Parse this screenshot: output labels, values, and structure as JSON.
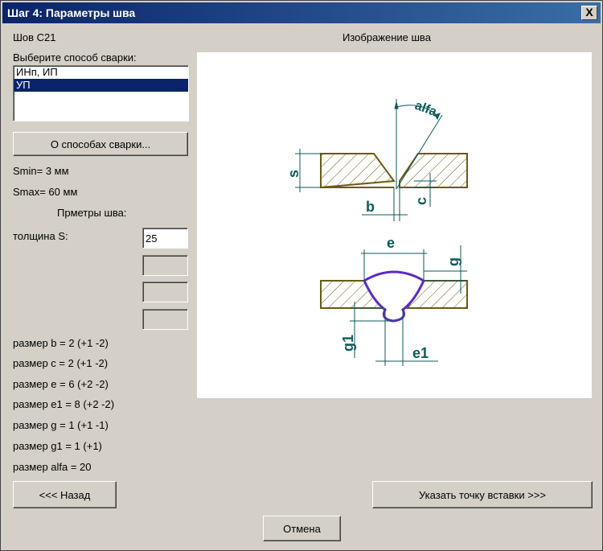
{
  "window": {
    "title": "Шаг 4: Параметры шва",
    "close_symbol": "X"
  },
  "seam_name": "Шов С21",
  "image_caption": "Изображение шва",
  "method_label": "Выберите способ сварки:",
  "methods": [
    "ИНп, ИП",
    "УП"
  ],
  "methods_selected": "УП",
  "about_button": "О способах сварки...",
  "smin": "Smin= 3 мм",
  "smax": "Smax= 60 мм",
  "params_heading": "Прметры шва:",
  "thickness_label": "толщина S:",
  "thickness_value": "25",
  "sizes": [
    "размер b = 2 (+1 -2)",
    "размер c = 2 (+1 -2)",
    "размер e = 6 (+2 -2)",
    "размер e1 = 8 (+2 -2)",
    "размер g = 1 (+1 -1)",
    "размер g1 = 1 (+1)",
    "размер alfa = 20"
  ],
  "buttons": {
    "back": "<<< Назад",
    "insert": "Указать точку вставки >>>",
    "cancel": "Отмена"
  },
  "drawing": {
    "labels": {
      "alfa": "alfa",
      "s": "s",
      "b": "b",
      "c": "c",
      "e": "e",
      "g": "g",
      "g1": "g1",
      "e1": "e1"
    },
    "colors": {
      "dimension": "#0f5a5a",
      "metal": "#6b5a10",
      "weld": "#5a2ac8"
    }
  }
}
